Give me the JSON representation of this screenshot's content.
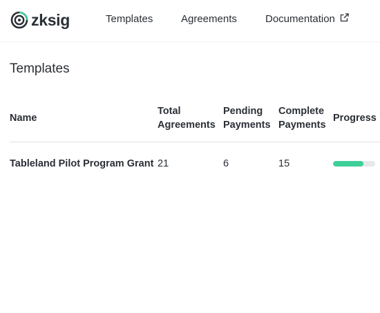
{
  "brand": {
    "name": "zksig",
    "logo_icon": "concentric-circle-logo",
    "accent_color": "#3ecf99"
  },
  "nav": {
    "templates": "Templates",
    "agreements": "Agreements",
    "documentation": "Documentation",
    "documentation_icon": "external-link-icon"
  },
  "page": {
    "title": "Templates"
  },
  "table": {
    "columns": {
      "name": "Name",
      "total_line1": "Total",
      "total_line2": "Agreements",
      "pending_line1": "Pending",
      "pending_line2": "Payments",
      "complete_line1": "Complete",
      "complete_line2": "Payments",
      "progress": "Progress"
    },
    "rows": [
      {
        "name": "Tableland Pilot Program Grant",
        "total_agreements": "21",
        "pending_payments": "6",
        "complete_payments": "15",
        "progress_fraction": 0.714
      }
    ]
  }
}
